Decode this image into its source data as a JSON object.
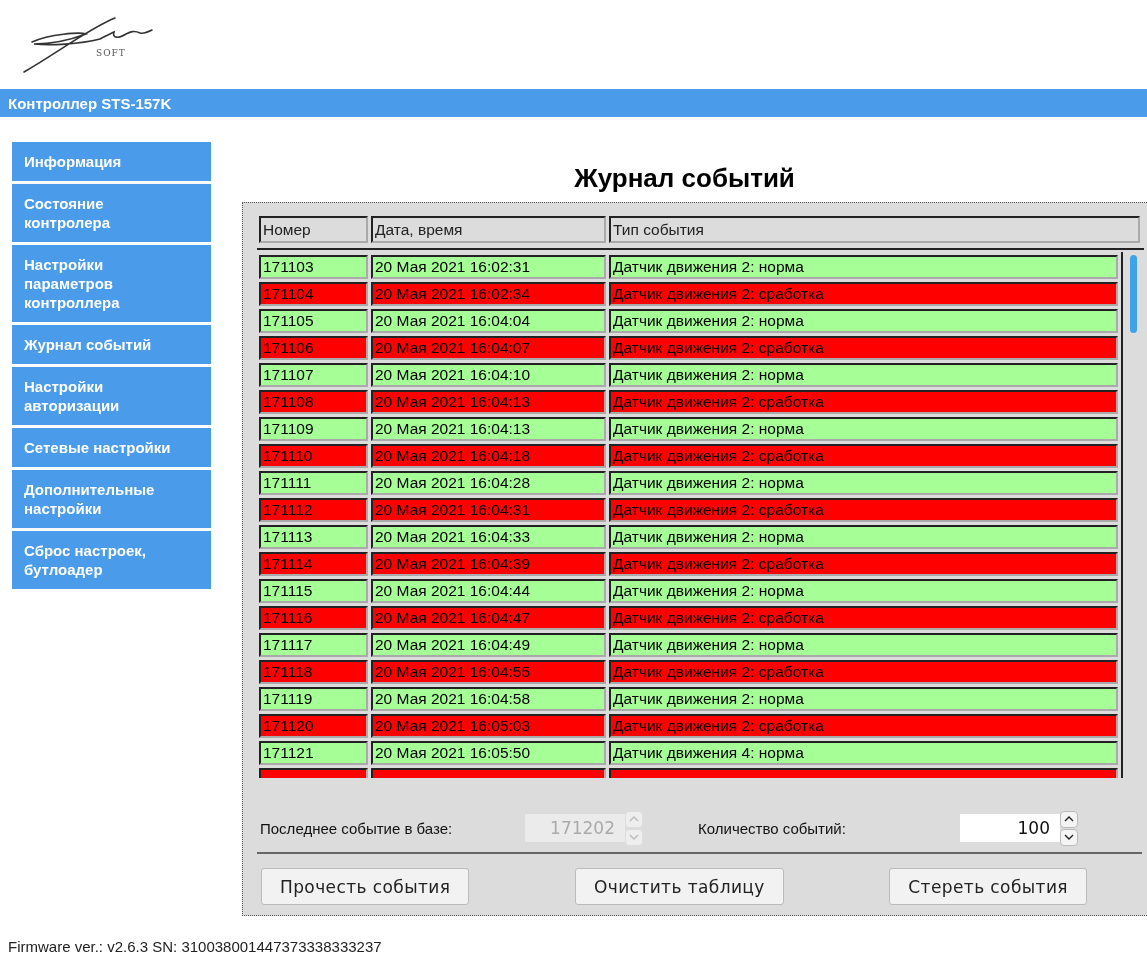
{
  "logo": {
    "subtext": "SOFT"
  },
  "header": {
    "title": "Контроллер STS-157K"
  },
  "sidebar": {
    "items": [
      {
        "label": "Информация"
      },
      {
        "label": "Состояние контролера"
      },
      {
        "label": "Настройки параметров контроллера"
      },
      {
        "label": "Журнал событий"
      },
      {
        "label": "Настройки авторизации"
      },
      {
        "label": "Сетевые настройки"
      },
      {
        "label": "Дополнительные настройки"
      },
      {
        "label": "Сброс настроек, бутлоадер"
      }
    ]
  },
  "page_title": "Журнал событий",
  "table": {
    "columns": [
      "Номер",
      "Дата, время",
      "Тип события"
    ],
    "rows": [
      {
        "color": "#a6fe96",
        "cells": [
          "171103",
          "20 Мая 2021 16:02:31",
          "Датчик движения 2: норма"
        ]
      },
      {
        "color": "#ff0000",
        "cells": [
          "171104",
          "20 Мая 2021 16:02:34",
          "Датчик движения 2: сработка"
        ]
      },
      {
        "color": "#a6fe96",
        "cells": [
          "171105",
          "20 Мая 2021 16:04:04",
          "Датчик движения 2: норма"
        ]
      },
      {
        "color": "#ff0000",
        "cells": [
          "171106",
          "20 Мая 2021 16:04:07",
          "Датчик движения 2: сработка"
        ]
      },
      {
        "color": "#a6fe96",
        "cells": [
          "171107",
          "20 Мая 2021 16:04:10",
          "Датчик движения 2: норма"
        ]
      },
      {
        "color": "#ff0000",
        "cells": [
          "171108",
          "20 Мая 2021 16:04:13",
          "Датчик движения 2: сработка"
        ]
      },
      {
        "color": "#a6fe96",
        "cells": [
          "171109",
          "20 Мая 2021 16:04:13",
          "Датчик движения 2: норма"
        ]
      },
      {
        "color": "#ff0000",
        "cells": [
          "171110",
          "20 Мая 2021 16:04:18",
          "Датчик движения 2: сработка"
        ]
      },
      {
        "color": "#a6fe96",
        "cells": [
          "171111",
          "20 Мая 2021 16:04:28",
          "Датчик движения 2: норма"
        ]
      },
      {
        "color": "#ff0000",
        "cells": [
          "171112",
          "20 Мая 2021 16:04:31",
          "Датчик движения 2: сработка"
        ]
      },
      {
        "color": "#a6fe96",
        "cells": [
          "171113",
          "20 Мая 2021 16:04:33",
          "Датчик движения 2: норма"
        ]
      },
      {
        "color": "#ff0000",
        "cells": [
          "171114",
          "20 Мая 2021 16:04:39",
          "Датчик движения 2: сработка"
        ]
      },
      {
        "color": "#a6fe96",
        "cells": [
          "171115",
          "20 Мая 2021 16:04:44",
          "Датчик движения 2: норма"
        ]
      },
      {
        "color": "#ff0000",
        "cells": [
          "171116",
          "20 Мая 2021 16:04:47",
          "Датчик движения 2: сработка"
        ]
      },
      {
        "color": "#a6fe96",
        "cells": [
          "171117",
          "20 Мая 2021 16:04:49",
          "Датчик движения 2: норма"
        ]
      },
      {
        "color": "#ff0000",
        "cells": [
          "171118",
          "20 Мая 2021 16:04:55",
          "Датчик движения 2: сработка"
        ]
      },
      {
        "color": "#a6fe96",
        "cells": [
          "171119",
          "20 Мая 2021 16:04:58",
          "Датчик движения 2: норма"
        ]
      },
      {
        "color": "#ff0000",
        "cells": [
          "171120",
          "20 Мая 2021 16:05:03",
          "Датчик движения 2: сработка"
        ]
      },
      {
        "color": "#a6fe96",
        "cells": [
          "171121",
          "20 Мая 2021 16:05:50",
          "Датчик движения 4: норма"
        ]
      },
      {
        "color": "#ff0000"
      }
    ]
  },
  "fields": [
    {
      "label": "Последнее событие в базе:",
      "value": "171202",
      "disabled": true
    },
    {
      "label": "Количество событий:",
      "value": "100",
      "disabled": false
    }
  ],
  "buttons": [
    "Прочесть события",
    "Очистить таблицу",
    "Стереть события"
  ],
  "footer": "Firmware ver.: v2.6.3 SN: 310038001447373338333237"
}
